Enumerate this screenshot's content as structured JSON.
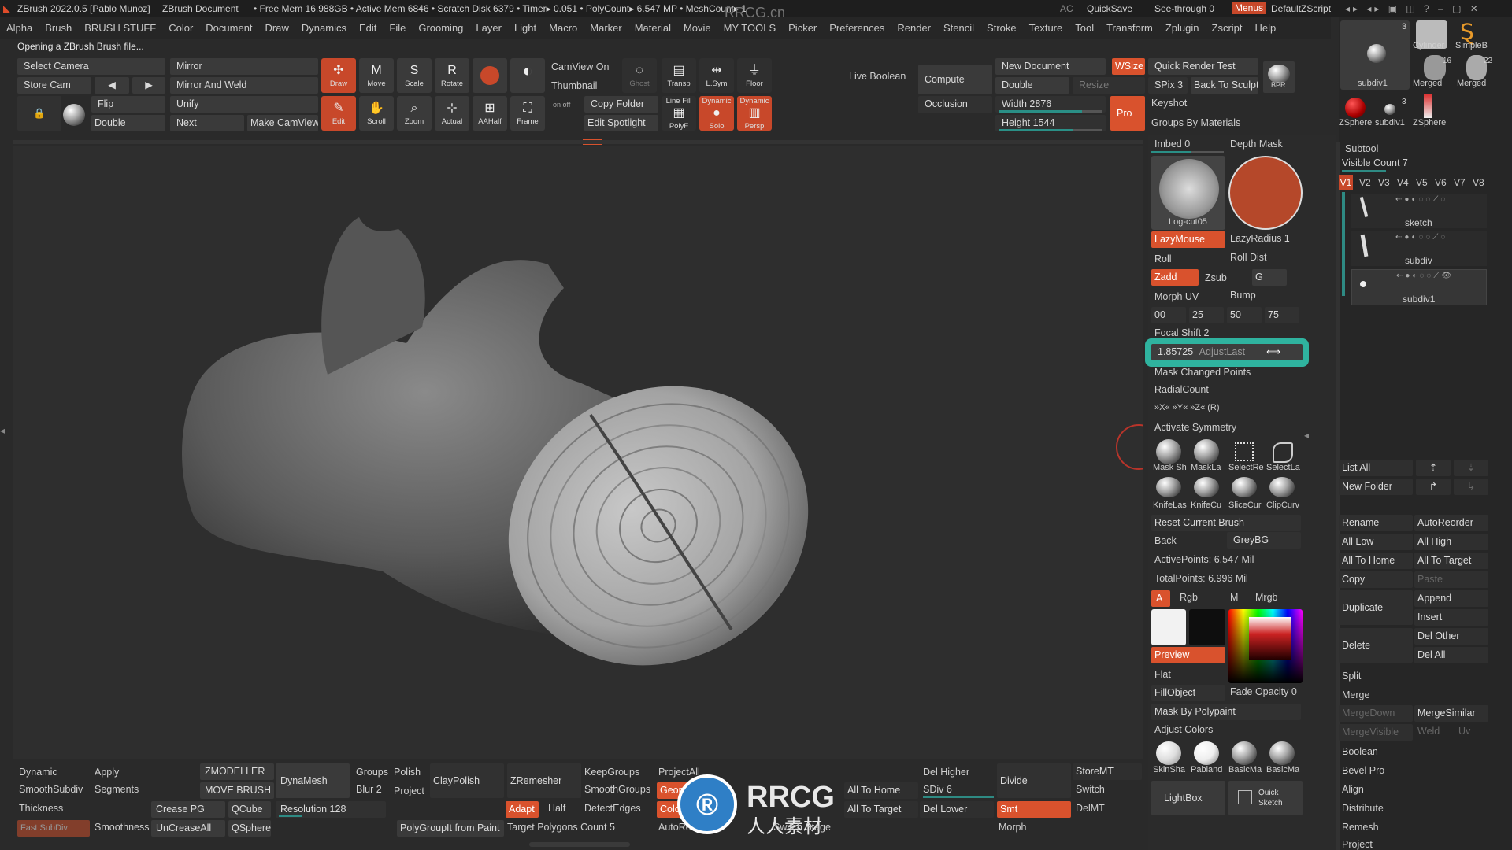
{
  "title_bar": {
    "app": "ZBrush 2022.0.5 [Pablo Munoz]",
    "doc": "ZBrush Document",
    "stats": "• Free Mem 16.988GB • Active Mem 6846 • Scratch Disk 6379 • Timer▸ 0.051 • PolyCount▸ 6.547 MP • MeshCount▸ 1",
    "watermark": "RRCG.cn",
    "ac": "AC",
    "quicksave": "QuickSave",
    "see_through": "See-through  0",
    "menus": "Menus",
    "default_script": "DefaultZScript"
  },
  "menu_items": [
    "Alpha",
    "Brush",
    "BRUSH STUFF",
    "Color",
    "Document",
    "Draw",
    "Dynamics",
    "Edit",
    "File",
    "Grooming",
    "Layer",
    "Light",
    "Macro",
    "Marker",
    "Material",
    "Movie",
    "MY TOOLS",
    "Picker",
    "Preferences",
    "Render",
    "Stencil",
    "Stroke",
    "Texture",
    "Tool",
    "Transform",
    "Zplugin",
    "Zscript",
    "Help"
  ],
  "status_text": "Opening a ZBrush Brush file...",
  "top_left": {
    "select_camera": "Select Camera",
    "store_cam": "Store Cam",
    "mirror": "Mirror",
    "mirror_weld": "Mirror And Weld",
    "flip": "Flip",
    "unify": "Unify",
    "double": "Double",
    "next": "Next",
    "make_camview": "Make CamView"
  },
  "tools": {
    "draw": "Draw",
    "move": "Move",
    "scale": "Scale",
    "rotate": "Rotate",
    "edit": "Edit",
    "scroll": "Scroll",
    "zoom": "Zoom",
    "actual": "Actual",
    "aahalf": "AAHalf",
    "frame": "Frame",
    "camview_on": "CamView On",
    "thumbnail": "Thumbnail",
    "copy_folder": "Copy Folder",
    "edit_spotlight": "Edit Spotlight",
    "ghost": "Ghost",
    "transp": "Transp",
    "lsym": "L.Sym",
    "floor": "Floor",
    "linefill": "Line Fill",
    "polyf": "PolyF",
    "solo": "Solo",
    "persp": "Persp",
    "dynamic": "Dynamic",
    "on_off": "on  off"
  },
  "render_area": {
    "live_boolean": "Live Boolean",
    "compute": "Compute",
    "occlusion": "Occlusion",
    "new_document": "New Document",
    "wsize": "WSize",
    "double": "Double",
    "resize": "Resize",
    "width": "Width 2876",
    "height": "Height 1544",
    "pro": "Pro",
    "quick_render_test": "Quick Render Test",
    "spix": "SPix 3",
    "back_to_sculpt": "Back To Sculpt",
    "bpr": "BPR",
    "keyshot": "Keyshot",
    "groups_by_materials": "Groups By Materials"
  },
  "brush_panel": {
    "imbed": "Imbed 0",
    "depth_mask": "Depth Mask",
    "alpha_name": "Log-cut05",
    "lazymouse": "LazyMouse",
    "lazyradius": "LazyRadius 1",
    "roll": "Roll",
    "roll_dist": "Roll Dist",
    "zadd": "Zadd",
    "zsub": "Zsub",
    "g": "G",
    "morph_uv": "Morph UV",
    "bump": "Bump",
    "v00": "00",
    "v25": "25",
    "v50": "50",
    "v75": "75",
    "focal_shift": "Focal Shift 2",
    "adjust_last_value": "1.85725",
    "adjust_last": "AdjustLast",
    "mask_changed_points": "Mask Changed Points",
    "radial_count": "RadialCount",
    "xyz": "»X«   »Y«   »Z«   (R)",
    "activate_symmetry": "Activate Symmetry",
    "brush_row1": [
      "Mask Sh",
      "MaskLa",
      "SelectRe",
      "SelectLa"
    ],
    "brush_row2": [
      "KnifeLas",
      "KnifeCu",
      "SliceCur",
      "ClipCurv"
    ],
    "reset_current_brush": "Reset Current Brush",
    "back": "Back",
    "greybg": "GreyBG",
    "active_points": "ActivePoints: 6.547 Mil",
    "total_points": "TotalPoints: 6.996 Mil",
    "a": "A",
    "rgb": "Rgb",
    "m": "M",
    "mrgb": "Mrgb",
    "preview": "Preview",
    "flat": "Flat",
    "fillobject": "FillObject",
    "fade_opacity": "Fade Opacity 0",
    "mask_by_polypaint": "Mask By Polypaint",
    "adjust_colors": "Adjust Colors",
    "materials": [
      "SkinSha",
      "Pabland",
      "BasicMa",
      "BasicMa"
    ],
    "lightbox": "LightBox",
    "quick_sketch": "Quick Sketch"
  },
  "tool_thumbs": {
    "n3a": "3",
    "cylinder": "Cylinder",
    "simpleb": "SimpleB",
    "n16": "16",
    "n22": "22",
    "subdiv1": "subdiv1",
    "merged1": "Merged",
    "merged2": "Merged",
    "n3b": "3",
    "zsphere1": "ZSphere",
    "subdiv1b": "subdiv1",
    "zsphere2": "ZSphere"
  },
  "subtool": {
    "title": "Subtool",
    "visible_count": "Visible Count 7",
    "versions": [
      "V1",
      "V2",
      "V3",
      "V4",
      "V5",
      "V6",
      "V7",
      "V8"
    ],
    "items": [
      "sketch",
      "subdiv",
      "subdiv1"
    ],
    "list_all": "List All",
    "new_folder": "New Folder",
    "rename": "Rename",
    "autoreorder": "AutoReorder",
    "all_low": "All Low",
    "all_high": "All High",
    "all_to_home": "All To Home",
    "all_to_target": "All To Target",
    "copy": "Copy",
    "paste": "Paste",
    "duplicate": "Duplicate",
    "append": "Append",
    "insert": "Insert",
    "delete": "Delete",
    "del_other": "Del Other",
    "del_all": "Del All",
    "split": "Split",
    "merge": "Merge",
    "mergedown": "MergeDown",
    "mergesimilar": "MergeSimilar",
    "mergevisible": "MergeVisible",
    "weld": "Weld",
    "uv": "Uv",
    "boolean": "Boolean",
    "bevel_pro": "Bevel Pro",
    "align": "Align",
    "distribute": "Distribute",
    "remesh": "Remesh",
    "project": "Project"
  },
  "bottom": {
    "dynamic": "Dynamic",
    "apply": "Apply",
    "smoothsubdiv": "SmoothSubdiv",
    "segments": "Segments",
    "thickness": "Thickness",
    "smoothness": "Smoothness",
    "fast_subdiv": "Fast SubDiv",
    "zmodeller": "ZMODELLER",
    "move_brush": "MOVE BRUSH",
    "crease_pg": "Crease PG",
    "qcube": "QCube",
    "uncreaseall": "UnCreaseAll",
    "qsphere": "QSphere",
    "dynamesh": "DynaMesh",
    "groups": "Groups",
    "polish": "Polish",
    "blur": "Blur 2",
    "project": "Project",
    "resolution": "Resolution 128",
    "claypolish": "ClayPolish",
    "polygroupit": "PolyGroupIt from Paint",
    "zremesher": "ZRemesher",
    "keepgroups": "KeepGroups",
    "smoothgroups": "SmoothGroups",
    "adapt": "Adapt",
    "half": "Half",
    "detectedges": "DetectEdges",
    "target_polys": "Target Polygons Count 5",
    "projectall": "ProjectAll",
    "geom": "Geom",
    "color": "Colo",
    "autore": "AutoRe",
    "all_to_home": "All To Home",
    "all_to_target": "All To Target",
    "switch_stage": "Switch Stage",
    "del_higher": "Del Higher",
    "sdiv": "SDiv 6",
    "del_lower": "Del Lower",
    "divide": "Divide",
    "smt": "Smt",
    "morph": "Morph",
    "storemt": "StoreMT",
    "switch": "Switch",
    "delmt": "DelMT",
    "watermark": "RRCG",
    "watermark_sub": "人人素材"
  }
}
